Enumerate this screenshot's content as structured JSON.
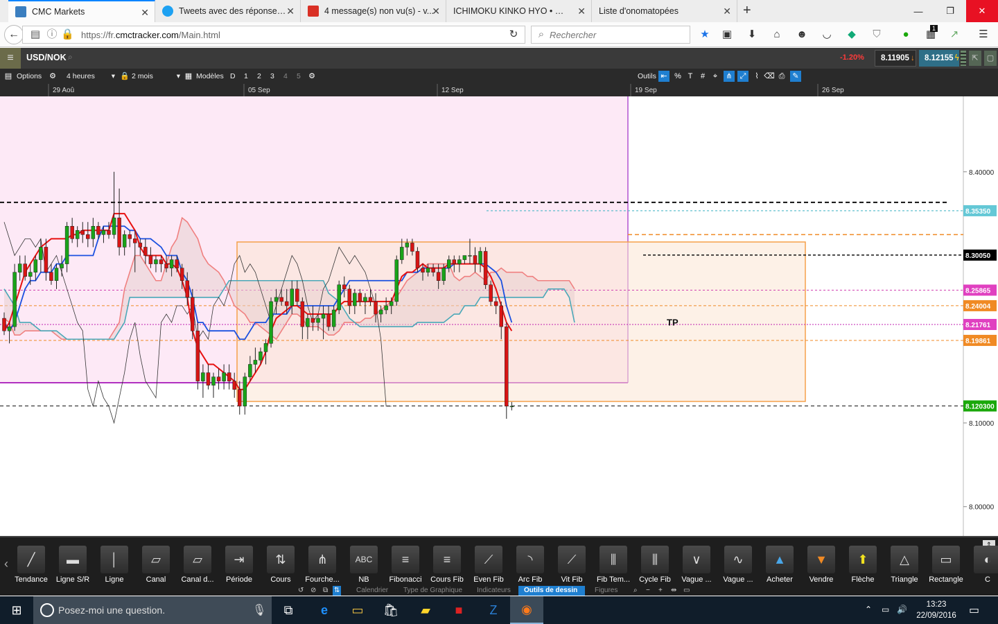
{
  "browser": {
    "tabs": [
      {
        "title": "CMC Markets",
        "favicon_color": "#3a7ebf"
      },
      {
        "title": "Tweets avec des réponses ...",
        "favicon_color": "#1da1f2"
      },
      {
        "title": "4 message(s) non vu(s) - v...",
        "favicon_color": "#d93025"
      },
      {
        "title": "ICHIMOKU KINKO HYO • Rép...",
        "favicon_color": "#bbbbbb"
      },
      {
        "title": "Liste d'onomatopées",
        "favicon_color": "#bbbbbb"
      }
    ],
    "url_prefix": "https://fr.",
    "url_domain": "cmctracker.com",
    "url_suffix": "/Main.html",
    "search_placeholder": "Rechercher",
    "badge_count": "1"
  },
  "app": {
    "symbol": "USD/NOK",
    "change": "-1.20%",
    "bid": "8.11905",
    "ask": "8.12155",
    "toolbar": {
      "options": "Options",
      "period": "4 heures",
      "range": "2 mois",
      "models": "Modèles",
      "d_buttons": [
        "D",
        "1",
        "2",
        "3",
        "4",
        "5"
      ],
      "tools_label": "Outils"
    }
  },
  "chart_data": {
    "type": "candlestick",
    "title": "USD/NOK",
    "x_labels": [
      "29 Aoû",
      "05 Sep",
      "12 Sep",
      "19 Sep",
      "26 Sep"
    ],
    "y_ticks": [
      8.4,
      8.1,
      8.0
    ],
    "y_tick_labels": [
      "8.40000",
      "8.10000",
      "8.00000"
    ],
    "ylim": [
      7.965,
      8.505
    ],
    "price_tags": [
      {
        "value": 8.3535,
        "label": "8.35350",
        "color": "#64c8d6"
      },
      {
        "value": 8.3005,
        "label": "8.30050",
        "color": "#000000"
      },
      {
        "value": 8.25865,
        "label": "8.25865",
        "color": "#e040c0"
      },
      {
        "value": 8.24004,
        "label": "8.24004",
        "color": "#f08a24"
      },
      {
        "value": 8.21761,
        "label": "8.21761",
        "color": "#e040c0"
      },
      {
        "value": 8.19861,
        "label": "8.19861",
        "color": "#f08a24"
      },
      {
        "value": 8.1203,
        "label": "8.120300",
        "color": "#1aa80a"
      }
    ],
    "annotation": "TP",
    "candles_ohlc": [
      [
        8.225,
        8.232,
        8.205,
        8.21
      ],
      [
        8.21,
        8.22,
        8.195,
        8.215
      ],
      [
        8.215,
        8.29,
        8.21,
        8.28
      ],
      [
        8.28,
        8.3,
        8.27,
        8.29
      ],
      [
        8.29,
        8.3,
        8.27,
        8.275
      ],
      [
        8.275,
        8.29,
        8.265,
        8.28
      ],
      [
        8.28,
        8.3,
        8.27,
        8.295
      ],
      [
        8.295,
        8.32,
        8.28,
        8.31
      ],
      [
        8.31,
        8.32,
        8.27,
        8.28
      ],
      [
        8.28,
        8.29,
        8.265,
        8.27
      ],
      [
        8.27,
        8.29,
        8.26,
        8.285
      ],
      [
        8.285,
        8.3,
        8.275,
        8.29
      ],
      [
        8.29,
        8.34,
        8.28,
        8.335
      ],
      [
        8.335,
        8.345,
        8.315,
        8.32
      ],
      [
        8.32,
        8.335,
        8.31,
        8.33
      ],
      [
        8.33,
        8.34,
        8.315,
        8.325
      ],
      [
        8.325,
        8.34,
        8.31,
        8.32
      ],
      [
        8.32,
        8.345,
        8.31,
        8.335
      ],
      [
        8.335,
        8.34,
        8.32,
        8.325
      ],
      [
        8.325,
        8.335,
        8.315,
        8.33
      ],
      [
        8.33,
        8.34,
        8.32,
        8.325
      ],
      [
        8.325,
        8.4,
        8.32,
        8.345
      ],
      [
        8.345,
        8.38,
        8.3,
        8.31
      ],
      [
        8.31,
        8.33,
        8.3,
        8.325
      ],
      [
        8.325,
        8.33,
        8.31,
        8.32
      ],
      [
        8.32,
        8.33,
        8.28,
        8.315
      ],
      [
        8.315,
        8.32,
        8.3,
        8.31
      ],
      [
        8.31,
        8.32,
        8.29,
        8.3
      ],
      [
        8.3,
        8.31,
        8.285,
        8.29
      ],
      [
        8.29,
        8.3,
        8.28,
        8.295
      ],
      [
        8.295,
        8.3,
        8.28,
        8.29
      ],
      [
        8.29,
        8.3,
        8.28,
        8.285
      ],
      [
        8.285,
        8.3,
        8.275,
        8.295
      ],
      [
        8.295,
        8.3,
        8.28,
        8.285
      ],
      [
        8.285,
        8.29,
        8.26,
        8.27
      ],
      [
        8.27,
        8.28,
        8.24,
        8.25
      ],
      [
        8.25,
        8.26,
        8.2,
        8.21
      ],
      [
        8.21,
        8.22,
        8.14,
        8.15
      ],
      [
        8.15,
        8.17,
        8.13,
        8.16
      ],
      [
        8.16,
        8.17,
        8.14,
        8.145
      ],
      [
        8.145,
        8.16,
        8.13,
        8.155
      ],
      [
        8.155,
        8.165,
        8.14,
        8.15
      ],
      [
        8.15,
        8.17,
        8.14,
        8.16
      ],
      [
        8.16,
        8.17,
        8.14,
        8.15
      ],
      [
        8.15,
        8.16,
        8.13,
        8.14
      ],
      [
        8.14,
        8.15,
        8.11,
        8.12
      ],
      [
        8.12,
        8.16,
        8.11,
        8.155
      ],
      [
        8.155,
        8.18,
        8.15,
        8.17
      ],
      [
        8.17,
        8.19,
        8.16,
        8.175
      ],
      [
        8.175,
        8.19,
        8.17,
        8.185
      ],
      [
        8.185,
        8.2,
        8.17,
        8.195
      ],
      [
        8.195,
        8.25,
        8.19,
        8.245
      ],
      [
        8.245,
        8.26,
        8.23,
        8.25
      ],
      [
        8.25,
        8.26,
        8.24,
        8.245
      ],
      [
        8.245,
        8.26,
        8.23,
        8.24
      ],
      [
        8.24,
        8.27,
        8.23,
        8.26
      ],
      [
        8.26,
        8.27,
        8.24,
        8.245
      ],
      [
        8.245,
        8.25,
        8.2,
        8.215
      ],
      [
        8.215,
        8.23,
        8.2,
        8.225
      ],
      [
        8.225,
        8.24,
        8.21,
        8.22
      ],
      [
        8.22,
        8.23,
        8.21,
        8.225
      ],
      [
        8.225,
        8.24,
        8.2,
        8.23
      ],
      [
        8.23,
        8.24,
        8.21,
        8.215
      ],
      [
        8.215,
        8.24,
        8.21,
        8.235
      ],
      [
        8.235,
        8.27,
        8.23,
        8.265
      ],
      [
        8.265,
        8.275,
        8.25,
        8.26
      ],
      [
        8.26,
        8.265,
        8.23,
        8.24
      ],
      [
        8.24,
        8.26,
        8.23,
        8.255
      ],
      [
        8.255,
        8.26,
        8.24,
        8.245
      ],
      [
        8.245,
        8.255,
        8.23,
        8.25
      ],
      [
        8.25,
        8.26,
        8.24,
        8.245
      ],
      [
        8.245,
        8.255,
        8.22,
        8.23
      ],
      [
        8.23,
        8.24,
        8.22,
        8.235
      ],
      [
        8.235,
        8.25,
        8.23,
        8.24
      ],
      [
        8.24,
        8.25,
        8.23,
        8.245
      ],
      [
        8.245,
        8.3,
        8.24,
        8.295
      ],
      [
        8.295,
        8.32,
        8.29,
        8.31
      ],
      [
        8.31,
        8.32,
        8.3,
        8.315
      ],
      [
        8.315,
        8.32,
        8.3,
        8.305
      ],
      [
        8.305,
        8.31,
        8.28,
        8.285
      ],
      [
        8.285,
        8.29,
        8.27,
        8.28
      ],
      [
        8.28,
        8.29,
        8.275,
        8.285
      ],
      [
        8.285,
        8.29,
        8.275,
        8.28
      ],
      [
        8.28,
        8.29,
        8.26,
        8.27
      ],
      [
        8.27,
        8.29,
        8.265,
        8.285
      ],
      [
        8.285,
        8.3,
        8.28,
        8.295
      ],
      [
        8.295,
        8.3,
        8.28,
        8.29
      ],
      [
        8.29,
        8.3,
        8.28,
        8.295
      ],
      [
        8.295,
        8.3,
        8.29,
        8.3
      ],
      [
        8.3,
        8.32,
        8.29,
        8.3
      ],
      [
        8.3,
        8.31,
        8.28,
        8.29
      ],
      [
        8.29,
        8.31,
        8.28,
        8.305
      ],
      [
        8.305,
        8.31,
        8.26,
        8.265
      ],
      [
        8.265,
        8.27,
        8.24,
        8.245
      ],
      [
        8.245,
        8.25,
        8.23,
        8.24
      ],
      [
        8.24,
        8.245,
        8.2,
        8.215
      ],
      [
        8.215,
        8.22,
        8.105,
        8.12
      ],
      [
        8.12,
        8.125,
        8.115,
        8.12
      ]
    ],
    "tenkan": [
      8.21,
      8.22,
      8.24,
      8.26,
      8.28,
      8.29,
      8.3,
      8.31,
      8.315,
      8.32,
      8.32,
      8.32,
      8.32,
      8.325,
      8.325,
      8.33,
      8.33,
      8.33,
      8.33,
      8.33,
      8.33,
      8.35,
      8.35,
      8.35,
      8.34,
      8.33,
      8.31,
      8.3,
      8.3,
      8.3,
      8.3,
      8.29,
      8.29,
      8.285,
      8.27,
      8.25,
      8.21,
      8.19,
      8.18,
      8.17,
      8.17,
      8.165,
      8.16,
      8.155,
      8.15,
      8.14,
      8.14,
      8.15,
      8.16,
      8.17,
      8.185,
      8.21,
      8.225,
      8.23,
      8.235,
      8.24,
      8.24,
      8.235,
      8.23,
      8.23,
      8.23,
      8.23,
      8.23,
      8.23,
      8.24,
      8.245,
      8.245,
      8.245,
      8.245,
      8.245,
      8.245,
      8.245,
      8.245,
      8.245,
      8.245,
      8.26,
      8.275,
      8.28,
      8.28,
      8.285,
      8.29,
      8.285,
      8.285,
      8.285,
      8.285,
      8.29,
      8.29,
      8.29,
      8.29,
      8.29,
      8.29,
      8.29,
      8.285,
      8.275,
      8.26,
      8.24,
      8.22,
      8.21
    ],
    "kijun": [
      8.22,
      8.21,
      8.22,
      8.24,
      8.26,
      8.27,
      8.27,
      8.28,
      8.28,
      8.28,
      8.29,
      8.29,
      8.3,
      8.3,
      8.3,
      8.3,
      8.3,
      8.3,
      8.32,
      8.335,
      8.335,
      8.335,
      8.335,
      8.335,
      8.33,
      8.33,
      8.32,
      8.32,
      8.32,
      8.315,
      8.31,
      8.3,
      8.3,
      8.3,
      8.28,
      8.27,
      8.25,
      8.22,
      8.22,
      8.21,
      8.21,
      8.21,
      8.21,
      8.21,
      8.21,
      8.2,
      8.2,
      8.21,
      8.22,
      8.22,
      8.22,
      8.23,
      8.23,
      8.23,
      8.23,
      8.24,
      8.24,
      8.24,
      8.24,
      8.24,
      8.24,
      8.24,
      8.24,
      8.24,
      8.25,
      8.26,
      8.27,
      8.27,
      8.27,
      8.27,
      8.27,
      8.27,
      8.27,
      8.27,
      8.27,
      8.27,
      8.27,
      8.28,
      8.28,
      8.28,
      8.285,
      8.285,
      8.285,
      8.285,
      8.285,
      8.285,
      8.29,
      8.29,
      8.29,
      8.29,
      8.29,
      8.29,
      8.29,
      8.285,
      8.28,
      8.27,
      8.24,
      8.22
    ],
    "chikou": [
      8.34,
      8.32,
      8.3,
      8.31,
      8.32,
      8.32,
      8.31,
      8.32,
      8.28,
      8.29,
      8.3,
      8.28,
      8.26,
      8.24,
      8.22,
      8.21,
      8.14,
      8.12,
      8.15,
      8.13,
      8.12,
      8.1,
      8.13,
      8.16,
      8.2,
      8.22,
      8.18,
      8.15,
      8.14,
      8.13,
      8.22,
      8.23,
      8.22,
      8.24,
      8.24,
      8.23,
      8.24,
      8.2,
      8.21,
      8.2,
      8.24,
      8.25,
      8.24,
      8.26,
      8.29,
      8.3,
      8.28,
      8.29,
      8.28,
      8.26,
      8.24,
      8.22,
      8.24,
      8.26,
      8.28,
      8.3,
      8.29,
      8.27,
      8.24,
      8.22,
      8.23,
      8.26,
      8.27,
      8.29,
      8.31,
      8.3,
      8.29,
      8.3,
      8.29,
      8.28,
      8.26,
      8.24,
      8.2,
      8.12,
      8.12
    ],
    "senkou_a": [
      8.225,
      8.22,
      8.205,
      8.205,
      8.21,
      8.21,
      8.21,
      8.21,
      8.21,
      8.21,
      8.205,
      8.2,
      8.2,
      8.2,
      8.2,
      8.2,
      8.2,
      8.2,
      8.2,
      8.2,
      8.2,
      8.21,
      8.22,
      8.26,
      8.28,
      8.3,
      8.3,
      8.29,
      8.28,
      8.27,
      8.27,
      8.29,
      8.31,
      8.32,
      8.345,
      8.34,
      8.33,
      8.32,
      8.3,
      8.29,
      8.285,
      8.28,
      8.27,
      8.255,
      8.24,
      8.235,
      8.23,
      8.22,
      8.22,
      8.215,
      8.21,
      8.205,
      8.2,
      8.21,
      8.22,
      8.23,
      8.23,
      8.225,
      8.215,
      8.215,
      8.215,
      8.21,
      8.205,
      8.205,
      8.21,
      8.22,
      8.22,
      8.22,
      8.22,
      8.225,
      8.225,
      8.23,
      8.235,
      8.24,
      8.245,
      8.25,
      8.26,
      8.27,
      8.275,
      8.28,
      8.285,
      8.29,
      8.29,
      8.29,
      8.29,
      8.29,
      8.275,
      8.27,
      8.275,
      8.275,
      8.28,
      8.275,
      8.27,
      8.28,
      8.28,
      8.285,
      8.28,
      8.28,
      8.28,
      8.28,
      8.275,
      8.275,
      8.27,
      8.27,
      8.27,
      8.27,
      8.27,
      8.27,
      8.27,
      8.26
    ],
    "senkou_b": [
      8.26,
      8.25,
      8.24,
      8.22,
      8.22,
      8.22,
      8.215,
      8.21,
      8.21,
      8.21,
      8.21,
      8.205,
      8.2,
      8.2,
      8.2,
      8.2,
      8.2,
      8.2,
      8.2,
      8.2,
      8.2,
      8.2,
      8.21,
      8.22,
      8.25,
      8.25,
      8.25,
      8.25,
      8.25,
      8.25,
      8.25,
      8.25,
      8.25,
      8.25,
      8.25,
      8.25,
      8.25,
      8.25,
      8.25,
      8.25,
      8.25,
      8.25,
      8.26,
      8.27,
      8.27,
      8.27,
      8.27,
      8.27,
      8.27,
      8.27,
      8.27,
      8.27,
      8.27,
      8.27,
      8.27,
      8.27,
      8.27,
      8.27,
      8.27,
      8.27,
      8.27,
      8.27,
      8.255,
      8.25,
      8.245,
      8.235,
      8.225,
      8.22,
      8.215,
      8.215,
      8.215,
      8.215,
      8.215,
      8.215,
      8.215,
      8.215,
      8.215,
      8.215,
      8.215,
      8.22,
      8.22,
      8.22,
      8.22,
      8.22,
      8.22,
      8.225,
      8.23,
      8.23,
      8.24,
      8.24,
      8.24,
      8.25,
      8.25,
      8.25,
      8.25,
      8.25,
      8.25,
      8.25,
      8.25,
      8.25,
      8.25,
      8.25,
      8.25,
      8.25,
      8.26,
      8.26,
      8.26,
      8.26,
      8.25,
      8.22
    ]
  },
  "drawing_tools": [
    "Tendance",
    "Ligne S/R",
    "Ligne",
    "Canal",
    "Canal d...",
    "Période",
    "Cours",
    "Fourche...",
    "NB",
    "Fibonacci",
    "Cours Fib",
    "Even Fib",
    "Arc Fib",
    "Vit Fib",
    "Fib Tem...",
    "Cycle Fib",
    "Vague ...",
    "Vague ...",
    "Acheter",
    "Vendre",
    "Flèche",
    "Triangle",
    "Rectangle",
    "C"
  ],
  "nb_icon_text": "ABC",
  "bottom_tabs": [
    "Calendrier",
    "Type de Graphique",
    "Indicateurs",
    "Outils de dessin",
    "Figures"
  ],
  "taskbar": {
    "search_placeholder": "Posez-moi une question.",
    "time": "13:23",
    "date": "22/09/2016"
  }
}
